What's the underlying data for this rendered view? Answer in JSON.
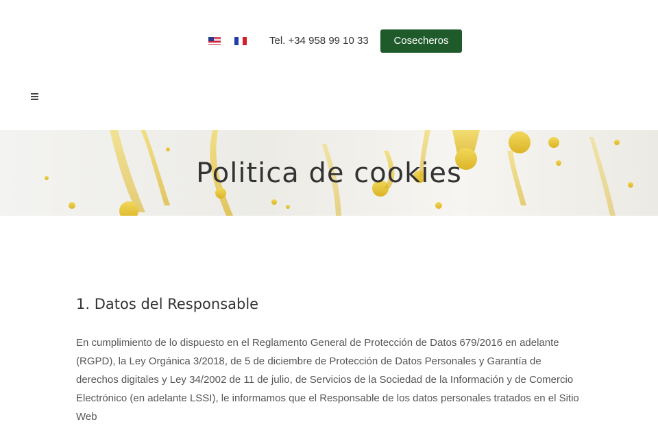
{
  "header": {
    "flags": [
      {
        "label": "English",
        "icon": "us-flag-icon"
      },
      {
        "label": "Français",
        "icon": "fr-flag-icon"
      }
    ],
    "phone": "Tel. +34 958 99 10 33",
    "cta_label": "Cosecheros",
    "cta_color": "#1f5a2b",
    "menu_icon": "hamburger-menu-icon"
  },
  "hero": {
    "title": "Politica de cookies",
    "background": "olive-oil-drops-image"
  },
  "content": {
    "section_title": "1. Datos del Responsable",
    "paragraph": "En cumplimiento de lo dispuesto en el Reglamento General de Protección de Datos 679/2016 en adelante (RGPD), la Ley Orgánica 3/2018, de 5 de diciembre de Protección de Datos Personales y Garantía de derechos digitales y Ley 34/2002 de 11 de julio, de Servicios de la Sociedad de la Información y de Comercio Electrónico (en adelante LSSI), le informamos que el Responsable de los datos personales tratados en el Sitio Web"
  }
}
